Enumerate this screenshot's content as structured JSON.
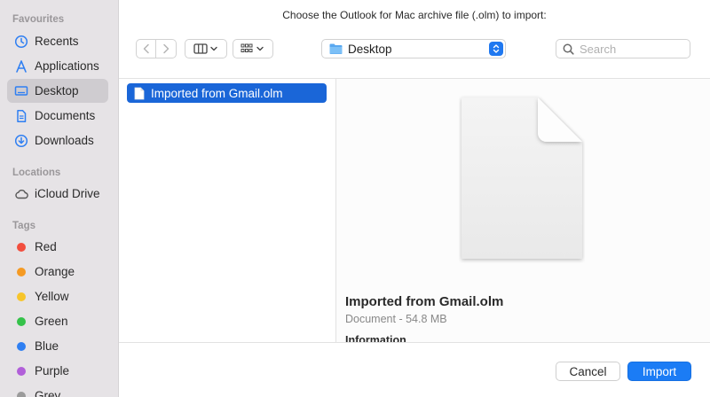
{
  "dialog": {
    "title": "Choose the Outlook for Mac archive file (.olm) to import:"
  },
  "sidebar": {
    "favourites_header": "Favourites",
    "favourites": [
      {
        "label": "Recents",
        "icon": "clock-icon"
      },
      {
        "label": "Applications",
        "icon": "applications-icon"
      },
      {
        "label": "Desktop",
        "icon": "desktop-icon",
        "selected": true
      },
      {
        "label": "Documents",
        "icon": "document-icon"
      },
      {
        "label": "Downloads",
        "icon": "download-icon"
      }
    ],
    "locations_header": "Locations",
    "locations": [
      {
        "label": "iCloud Drive",
        "icon": "cloud-icon"
      }
    ],
    "tags_header": "Tags",
    "tags": [
      {
        "label": "Red",
        "color": "#f24e3e"
      },
      {
        "label": "Orange",
        "color": "#f59a23"
      },
      {
        "label": "Yellow",
        "color": "#f7c52b"
      },
      {
        "label": "Green",
        "color": "#35c24a"
      },
      {
        "label": "Blue",
        "color": "#2f7ff2"
      },
      {
        "label": "Purple",
        "color": "#b15fd9"
      },
      {
        "label": "Grey",
        "color": "#9b9b9b"
      }
    ]
  },
  "toolbar": {
    "location": "Desktop",
    "search_placeholder": "Search"
  },
  "files": [
    {
      "name": "Imported from Gmail.olm",
      "selected": true
    }
  ],
  "preview": {
    "name": "Imported from Gmail.olm",
    "meta": "Document - 54.8 MB",
    "info_header": "Information"
  },
  "buttons": {
    "cancel": "Cancel",
    "import": "Import"
  },
  "colors": {
    "accent": "#1b7cf5",
    "selection": "#1a66d8"
  }
}
